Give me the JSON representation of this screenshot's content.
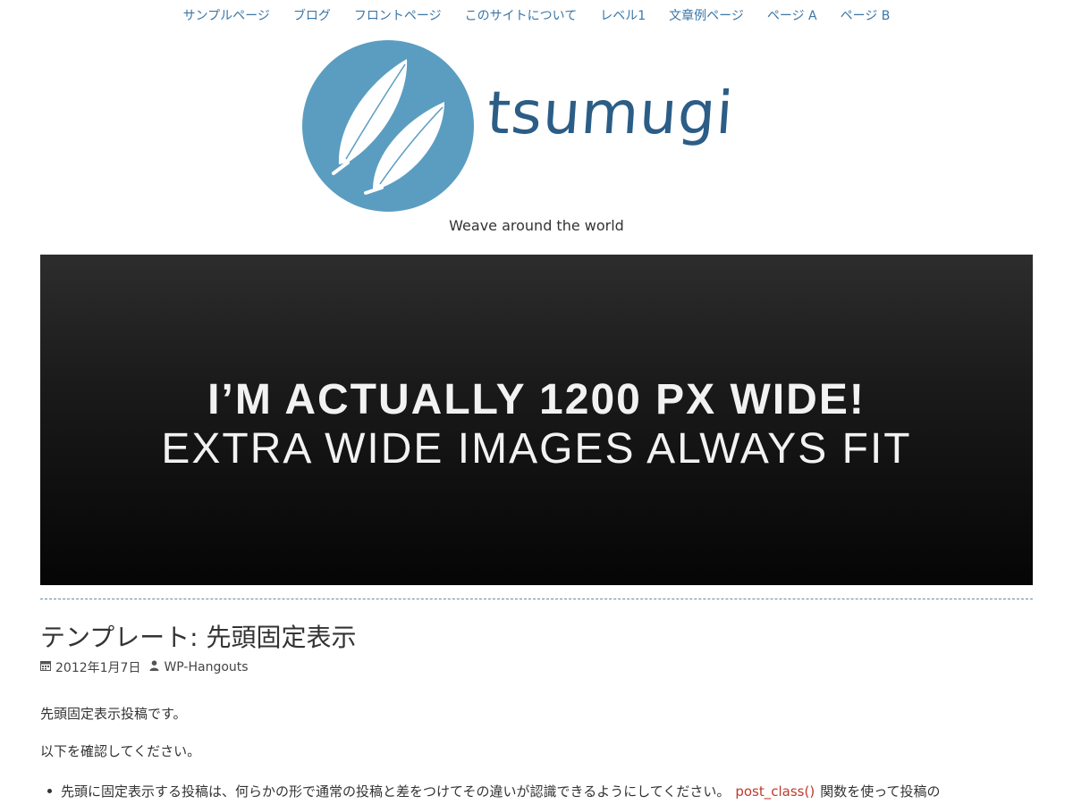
{
  "nav": {
    "items": [
      {
        "label": "サンプルページ"
      },
      {
        "label": "ブログ"
      },
      {
        "label": "フロントページ"
      },
      {
        "label": "このサイトについて"
      },
      {
        "label": "レベル1"
      },
      {
        "label": "文章例ページ"
      },
      {
        "label": "ページ A"
      },
      {
        "label": "ページ B"
      }
    ]
  },
  "site": {
    "logo_text": "tsumugi",
    "tagline": "Weave around the world",
    "logo_color": "#5b9dc1"
  },
  "hero": {
    "line1": "I’M ACTUALLY 1200 PX WIDE!",
    "line2": "EXTRA WIDE IMAGES ALWAYS FIT"
  },
  "post": {
    "title": "テンプレート: 先頭固定表示",
    "date": "2012年1月7日",
    "author": "WP-Hangouts",
    "date_icon": "calendar-icon",
    "author_icon": "user-icon",
    "paragraph1": "先頭固定表示投稿です。",
    "paragraph2": "以下を確認してください。",
    "bullet_before": "先頭に固定表示する投稿は、何らかの形で通常の投稿と差をつけてその違いが認識できるようにしてください。",
    "bullet_link": "post_class()",
    "bullet_after": "関数を使って投稿の"
  }
}
